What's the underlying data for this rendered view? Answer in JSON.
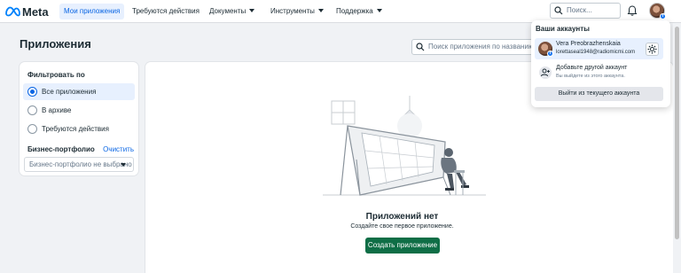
{
  "nav": {
    "logo": "Meta",
    "items": [
      {
        "label": "Мои приложения",
        "active": true
      },
      {
        "label": "Требуются действия",
        "dropdown": false
      },
      {
        "label": "Документы",
        "dropdown": true
      },
      {
        "label": "Инструменты",
        "dropdown": true
      },
      {
        "label": "Поддержка",
        "dropdown": true
      }
    ],
    "search_placeholder": "Поиск..."
  },
  "page": {
    "title": "Приложения",
    "search_placeholder": "Поиск приложения по названию или"
  },
  "filter": {
    "title": "Фильтровать по",
    "options": [
      {
        "label": "Все приложения",
        "selected": true
      },
      {
        "label": "В архиве",
        "selected": false
      },
      {
        "label": "Требуются действия",
        "selected": false
      }
    ],
    "business_portfolio": {
      "title": "Бизнес-портфолио",
      "clear_label": "Очистить",
      "select_value": "Бизнес-портфолио не выбрано"
    }
  },
  "empty_state": {
    "title": "Приложений нет",
    "subtitle": "Создайте свое первое приложение.",
    "button_label": "Создать приложение"
  },
  "accounts": {
    "title": "Ваши аккаунты",
    "current": {
      "name": "Vera Preobrazhenskaia",
      "email": "lorettaseal1948@radiomicmi.com"
    },
    "add": {
      "title": "Добавьте другой аккаунт",
      "subtitle": "Вы выйдете из этого аккаунта."
    },
    "logout_label": "Выйти из текущего аккаунта"
  },
  "colors": {
    "primary_blue": "#0b66e4",
    "create_green": "#0f6e46",
    "meta_blue": "#0081fb"
  }
}
